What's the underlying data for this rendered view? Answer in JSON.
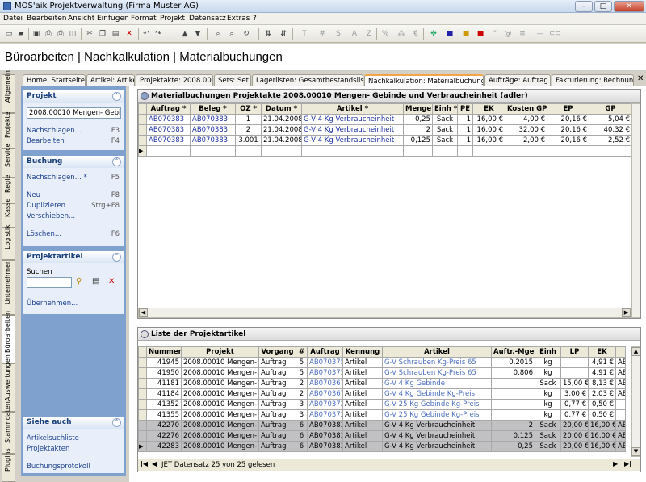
{
  "window": {
    "title": "MOS'aik Projektverwaltung (Firma Muster AG)"
  },
  "menu": [
    "Datei",
    "Bearbeiten",
    "Ansicht",
    "Einfügen",
    "Format",
    "Projekt",
    "Datensatz",
    "Extras",
    "?"
  ],
  "page_title": "Büroarbeiten | Nachkalkulation | Materialbuchungen",
  "vtabs": [
    "Allgemein",
    "Projekte",
    "Service",
    "Regie",
    "Kasse",
    "Logistik",
    "Unternehmer",
    "Büroarbeiten",
    "Auswertungen",
    "Stammdaten",
    "Plugins"
  ],
  "tabs": [
    "Home: Startseite",
    "Artikel: Artikel",
    "Projektakte: 2008.000",
    "Sets: Set",
    "Lagerlisten: Gesamtbestandsliste",
    "Nachkalkulation: Materialbuchungen",
    "Aufträge: Auftrag",
    "Fakturierung: Rechnung"
  ],
  "sidebar": {
    "projekt": {
      "title": "Projekt",
      "field_value": "2008.00010 Mengen- Gebinde",
      "nachschlagen": "Nachschlagen...",
      "nachschlagen_key": "F3",
      "bearbeiten": "Bearbeiten",
      "bearbeiten_key": "F4"
    },
    "buchung": {
      "title": "Buchung",
      "nachschlagen": "Nachschlagen... *",
      "nachschlagen_key": "F5",
      "neu": "Neu",
      "neu_key": "F8",
      "duplizieren": "Duplizieren",
      "duplizieren_key": "Strg+F8",
      "verschieben": "Verschieben...",
      "loeschen": "Löschen...",
      "loeschen_key": "F6"
    },
    "projektartikel": {
      "title": "Projektartikel",
      "suchen": "Suchen",
      "uebernehmen": "Übernehmen..."
    },
    "siehe_auch": {
      "title": "Siehe auch",
      "artikelsuchliste": "Artikelsuchliste",
      "projektakten": "Projektakten",
      "buchungsprotokoll": "Buchungsprotokoll"
    }
  },
  "grid1": {
    "title": "Materialbuchungen Projektakte 2008.00010 Mengen- Gebinde und Verbraucheinheit (adler)",
    "columns": [
      "Auftrag *",
      "Beleg *",
      "OZ *",
      "Datum *",
      "Artikel *",
      "Menge",
      "Einh *",
      "PE",
      "EK",
      "Kosten GP",
      "EP",
      "GP"
    ],
    "rows": [
      [
        "AB070383",
        "AB070383",
        "1",
        "21.04.2008",
        "G-V 4 Kg Verbraucheinheit",
        "0,25",
        "Sack",
        "1",
        "16,00 €",
        "4,00 €",
        "20,16 €",
        "5,04 €"
      ],
      [
        "AB070383",
        "AB070383",
        "2",
        "21.04.2008",
        "G-V 4 Kg Verbraucheinheit",
        "2",
        "Sack",
        "1",
        "16,00 €",
        "32,00 €",
        "20,16 €",
        "40,32 €"
      ],
      [
        "AB070383",
        "AB070383",
        "3.001",
        "21.04.2008",
        "G-V 4 Kg Verbraucheinheit",
        "0,125",
        "Sack",
        "1",
        "16,00 €",
        "2,00 €",
        "20,16 €",
        "2,52 €"
      ]
    ]
  },
  "grid2": {
    "title": "Liste der Projektartikel",
    "columns": [
      "Nummer",
      "Projekt",
      "Vorgang",
      "#",
      "Auftrag",
      "Kennung",
      "Artikel",
      "Auftr.-Mge",
      "Einh",
      "LP",
      "EK"
    ],
    "rows": [
      [
        "41945",
        "2008.00010 Mengen-",
        "Auftrag",
        "5",
        "AB070375",
        "Artikel",
        "G-V Schrauben Kg-Preis 65",
        "0,2015",
        "kg",
        "",
        "4,91 €",
        "AB"
      ],
      [
        "41950",
        "2008.00010 Mengen-",
        "Auftrag",
        "5",
        "AB070375",
        "Artikel",
        "G-V Schrauben Kg-Preis 65",
        "0,806",
        "kg",
        "",
        "4,91 €",
        "AB"
      ],
      [
        "41181",
        "2008.00010 Mengen-",
        "Auftrag",
        "2",
        "AB070367",
        "Artikel",
        "G-V 4 Kg Gebinde",
        "",
        "Sack",
        "15,00 €",
        "8,13 €",
        "AB"
      ],
      [
        "41184",
        "2008.00010 Mengen-",
        "Auftrag",
        "2",
        "AB070367",
        "Artikel",
        "G-V 4 Kg Gebinde Kg-Preis",
        "",
        "kg",
        "3,00 €",
        "2,03 €",
        "AB"
      ],
      [
        "41352",
        "2008.00010 Mengen-",
        "Auftrag",
        "3",
        "AB070372",
        "Artikel",
        "G-V 25 Kg Gebinde Kg-Preis",
        "",
        "kg",
        "0,77 €",
        "0,50 €",
        ""
      ],
      [
        "41355",
        "2008.00010 Mengen-",
        "Auftrag",
        "3",
        "AB070372",
        "Artikel",
        "G-V 25 Kg Gebinde Kg-Preis",
        "",
        "kg",
        "0,77 €",
        "0,50 €",
        ""
      ],
      [
        "42270",
        "2008.00010 Mengen-",
        "Auftrag",
        "6",
        "AB070383",
        "Artikel",
        "G-V 4 Kg Verbraucheinheit",
        "2",
        "Sack",
        "20,00 €",
        "16,00 €",
        "AB"
      ],
      [
        "42276",
        "2008.00010 Mengen-",
        "Auftrag",
        "6",
        "AB070383",
        "Artikel",
        "G-V 4 Kg Verbraucheinheit",
        "0,125",
        "Sack",
        "20,00 €",
        "16,00 €",
        "AB"
      ],
      [
        "42283",
        "2008.00010 Mengen-",
        "Auftrag",
        "6",
        "AB070383",
        "Artikel",
        "G-V 4 Kg Verbraucheinheit",
        "0,25",
        "Sack",
        "20,00 €",
        "16,00 €",
        "AB"
      ]
    ],
    "status": "JET Datensatz 25 von 25 gelesen"
  }
}
